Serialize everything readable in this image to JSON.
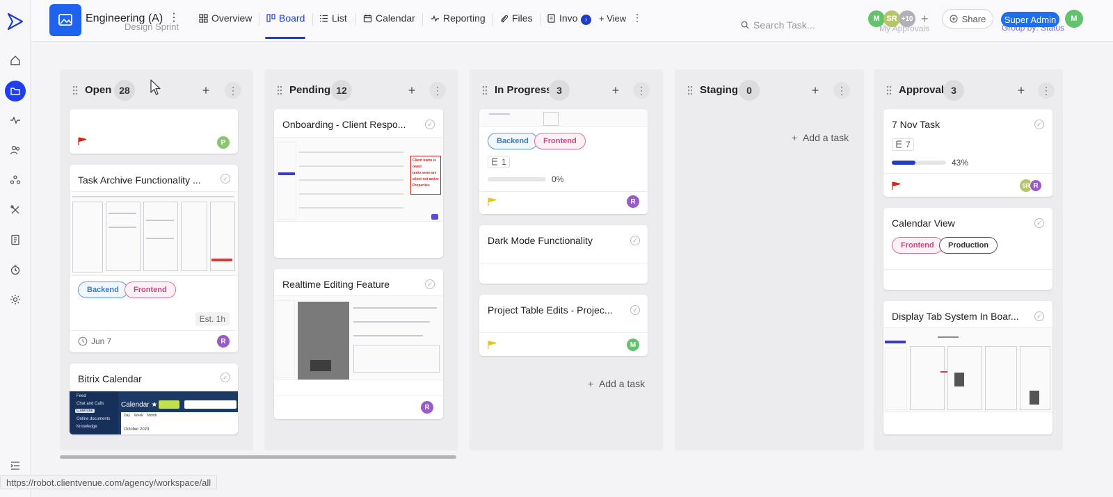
{
  "project": {
    "title": "Engineering (A)",
    "subtitle": "Design Sprint"
  },
  "nav": [
    "Overview",
    "Board",
    "List",
    "Calendar",
    "Reporting",
    "Files",
    "Invo"
  ],
  "active_nav": "Board",
  "add_view": "+ View",
  "search_placeholder": "Search Task...",
  "ghost_text": "My Approvals",
  "group_by": "Group by: Status",
  "avatars": [
    {
      "initials": "M",
      "color": "#62c36c"
    },
    {
      "initials": "SR",
      "color": "#b5c56a"
    },
    {
      "initials": "+10",
      "color": "#b0b0b8"
    }
  ],
  "share_label": "Share",
  "admin_label": "Super Admin",
  "user_avatar": {
    "initials": "M",
    "color": "#62c36c"
  },
  "columns": [
    {
      "title": "Open",
      "count": "28"
    },
    {
      "title": "Pending",
      "count": "12"
    },
    {
      "title": "In Progress",
      "count": "3"
    },
    {
      "title": "Staging",
      "count": "0"
    },
    {
      "title": "Approval",
      "count": "3"
    }
  ],
  "cards": {
    "open_top": {
      "avatar": "P",
      "avatar_color": "#8bc56e",
      "flag_color": "#d62020"
    },
    "task_archive": {
      "title": "Task Archive Functionality ...",
      "tags": [
        "Backend",
        "Frontend"
      ],
      "estimate": "Est. 1h",
      "due": "Jun 7",
      "avatar": "R",
      "avatar_color": "#9a5ac8"
    },
    "bitrix": {
      "title": "Bitrix Calendar",
      "thumb_text": [
        "Feed",
        "Chat and Calls",
        "Calendar",
        "Online documents",
        "Knowledge",
        "Calendar ★",
        "Day",
        "Week",
        "Month",
        "October 2023"
      ]
    },
    "onboarding": {
      "title": "Onboarding - Client Respo...",
      "thumb_text": [
        "Client name is owed",
        "tasks were are",
        "client not active",
        "Properties"
      ]
    },
    "realtime": {
      "title": "Realtime Editing Feature",
      "avatar": "R",
      "avatar_color": "#9a5ac8"
    },
    "inprog_top": {
      "tags": [
        "Backend",
        "Frontend"
      ],
      "subtasks": "1",
      "progress": "0%",
      "progress_value": 0,
      "avatar": "R",
      "avatar_color": "#9a5ac8",
      "flag_color": "#e6c520"
    },
    "dark_mode": {
      "title": "Dark Mode Functionality"
    },
    "project_table": {
      "title": "Project Table Edits - Projec...",
      "avatar": "M",
      "avatar_color": "#62c36c",
      "flag_color": "#e6c520"
    },
    "nov_task": {
      "title": "7 Nov Task",
      "subtasks": "7",
      "progress": "43%",
      "progress_value": 0.43,
      "avatars": [
        {
          "initials": "SR",
          "color": "#b5c56a"
        },
        {
          "initials": "R",
          "color": "#9a5ac8"
        }
      ],
      "flag_color": "#d62020"
    },
    "calendar_view": {
      "title": "Calendar View",
      "tags": [
        "Frontend",
        "Production"
      ]
    },
    "display_tab": {
      "title": "Display Tab System In Boar..."
    }
  },
  "add_task": "Add a task",
  "status_url": "https://robot.clientvenue.com/agency/workspace/all"
}
